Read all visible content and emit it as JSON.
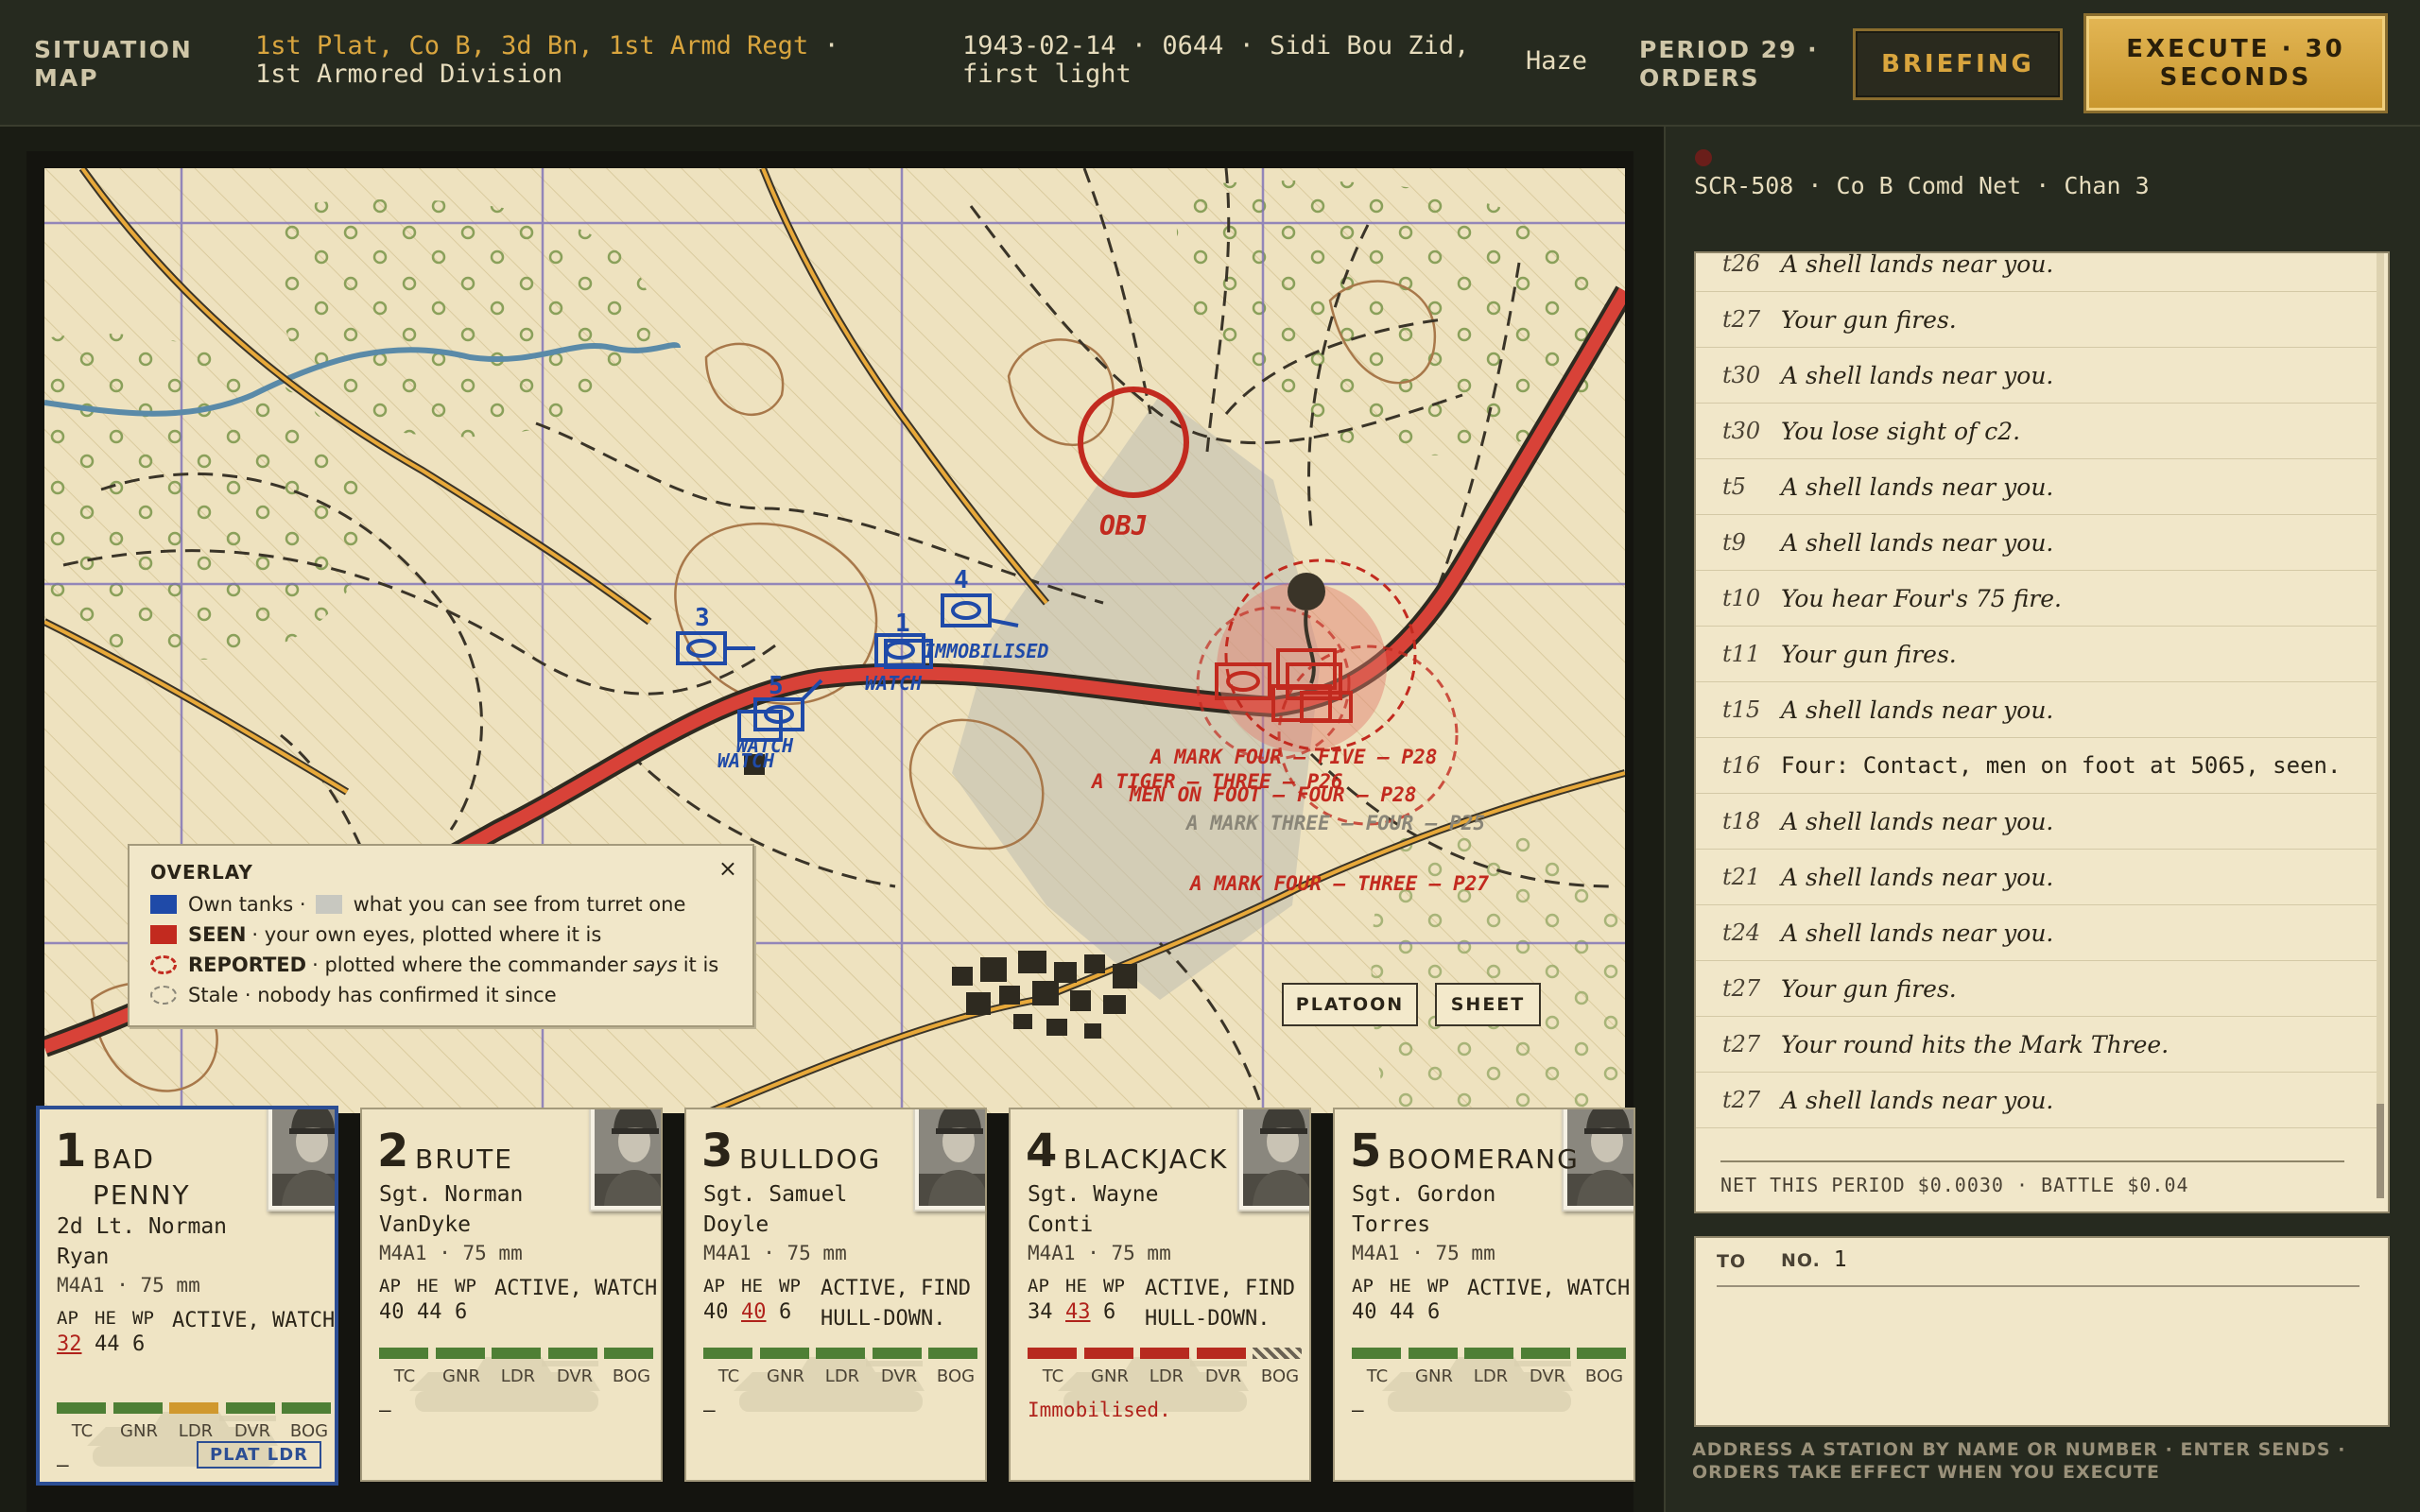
{
  "header": {
    "title": "SITUATION MAP",
    "unit_accent": "1st Plat, Co B, 3d Bn, 1st Armd Regt",
    "unit_rest": " · 1st Armored Division",
    "datetime": "1943-02-14 · 0644 · Sidi Bou Zid, first light",
    "weather": "Haze",
    "period": "PERIOD 29 · ORDERS",
    "briefing_label": "BRIEFING",
    "execute_label": "EXECUTE · 30 SECONDS"
  },
  "map": {
    "objective_label": "OBJ",
    "units": [
      {
        "id": "1",
        "label": "1"
      },
      {
        "id": "3",
        "label": "3"
      },
      {
        "id": "4",
        "label": "4"
      },
      {
        "id": "5",
        "label": "5"
      }
    ],
    "unit_tags": {
      "immobilised": "IMMOBILISED",
      "watch_1": "WATCH",
      "watch_5a": "WATCH",
      "watch_5b": "WATCH"
    },
    "contacts": {
      "reported_1": "A MARK FOUR — FIVE — P28",
      "reported_2": "A TIGER — THREE — P26",
      "reported_3": "MEN ON FOOT — FOUR — P28",
      "stale_1": "A MARK THREE — FOUR — P25",
      "seen_1": "A MARK FOUR — THREE — P27"
    },
    "colors": {
      "own": "#1f4aa8",
      "seen": "#c22a1f",
      "stale": "#8a8678",
      "road_main": "#d84238",
      "road_minor": "#e8a93a",
      "river": "#5a8aa8"
    },
    "overlay": {
      "title": "OVERLAY",
      "close_icon": "×",
      "row1_a": "Own tanks ·",
      "row1_b": "what you can see from turret one",
      "row2_bold": "SEEN",
      "row2_rest": "· your own eyes, plotted where it is",
      "row3_bold": "REPORTED",
      "row3_rest_a": "· plotted where the commander",
      "row3_em": "says",
      "row3_rest_b": "it is",
      "row4": "Stale · nobody has confirmed it since"
    },
    "platoon_label": "PLATOON",
    "sheet_label": "SHEET"
  },
  "crew_labels": [
    "TC",
    "GNR",
    "LDR",
    "DVR",
    "BOG"
  ],
  "ammo_labels": [
    "AP",
    "HE",
    "WP"
  ],
  "tanks": [
    {
      "num": "1",
      "name": "BAD PENNY",
      "commander": "2d Lt. Norman Ryan",
      "model": "M4A1 · 75 mm",
      "ap": "32",
      "he": "44",
      "wp": "6",
      "status": "ACTIVE, WATCH.",
      "note": "—",
      "badge": "PLAT LDR"
    },
    {
      "num": "2",
      "name": "BRUTE",
      "commander": "Sgt. Norman VanDyke",
      "model": "M4A1 · 75 mm",
      "ap": "40",
      "he": "44",
      "wp": "6",
      "status": "ACTIVE, WATCH.",
      "note": "—"
    },
    {
      "num": "3",
      "name": "BULLDOG",
      "commander": "Sgt. Samuel Doyle",
      "model": "M4A1 · 75 mm",
      "ap": "40",
      "he": "40",
      "wp": "6",
      "status": "ACTIVE, FIND HULL-DOWN.",
      "note": "—"
    },
    {
      "num": "4",
      "name": "BLACKJACK",
      "commander": "Sgt. Wayne Conti",
      "model": "M4A1 · 75 mm",
      "ap": "34",
      "he": "43",
      "wp": "6",
      "status": "ACTIVE, FIND HULL-DOWN.",
      "note": "Immobilised."
    },
    {
      "num": "5",
      "name": "BOOMERANG",
      "commander": "Sgt. Gordon Torres",
      "model": "M4A1 · 75 mm",
      "ap": "40",
      "he": "44",
      "wp": "6",
      "status": "ACTIVE, WATCH.",
      "note": "—"
    }
  ],
  "radio": {
    "title": "SCR-508 · Co B Comd Net · Chan 3",
    "log": [
      {
        "t": "t26",
        "msg": "A shell lands near you."
      },
      {
        "t": "t27",
        "msg": "Your gun fires."
      },
      {
        "t": "t30",
        "msg": "A shell lands near you."
      },
      {
        "t": "t30",
        "msg": "You lose sight of c2."
      },
      {
        "t": "t5",
        "msg": "A shell lands near you."
      },
      {
        "t": "t9",
        "msg": "A shell lands near you."
      },
      {
        "t": "t10",
        "msg": "You hear Four's 75 fire."
      },
      {
        "t": "t11",
        "msg": "Your gun fires."
      },
      {
        "t": "t15",
        "msg": "A shell lands near you."
      },
      {
        "t": "t16",
        "msg": "Four: Contact, men on foot at 5065, seen."
      },
      {
        "t": "t18",
        "msg": "A shell lands near you."
      },
      {
        "t": "t21",
        "msg": "A shell lands near you."
      },
      {
        "t": "t24",
        "msg": "A shell lands near you."
      },
      {
        "t": "t27",
        "msg": "Your gun fires."
      },
      {
        "t": "t27",
        "msg": "Your round hits the Mark Three."
      },
      {
        "t": "t27",
        "msg": "A shell lands near you."
      }
    ],
    "footer": "NET THIS PERIOD $0.0030 · BATTLE $0.04",
    "to_label": "TO",
    "to_no": "NO.",
    "to_value": "1",
    "order_text": "",
    "hint": "ADDRESS A STATION BY NAME OR NUMBER · ENTER SENDS · ORDERS TAKE EFFECT WHEN YOU EXECUTE"
  }
}
